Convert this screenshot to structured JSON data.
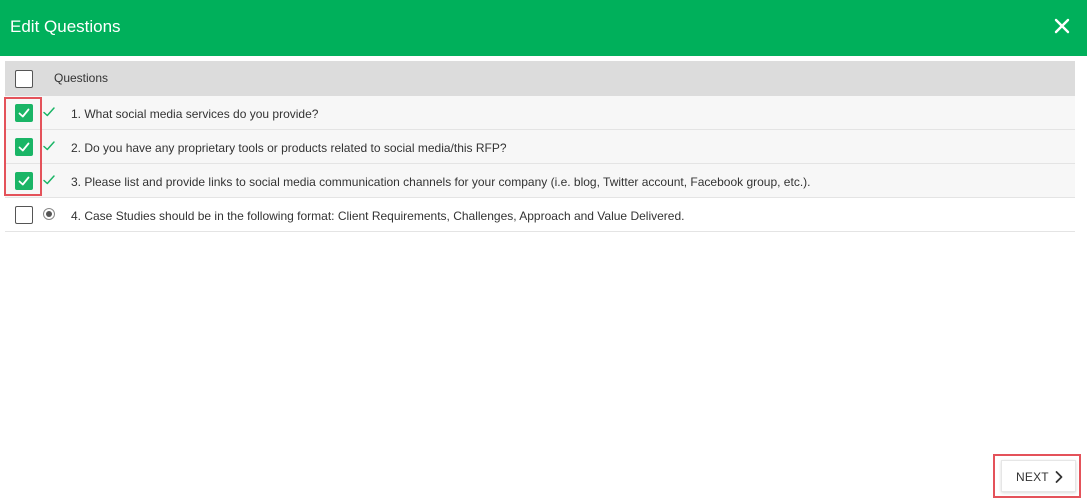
{
  "dialog": {
    "title": "Edit Questions"
  },
  "table": {
    "header_label": "Questions",
    "header_selected": false,
    "rows": [
      {
        "text": "1. What social media services do you provide?",
        "selected": true,
        "status": "check-icon"
      },
      {
        "text": "2. Do you have any proprietary tools or products related to social media/this RFP?",
        "selected": true,
        "status": "check-icon"
      },
      {
        "text": "3. Please list and provide links to social media communication channels for your company (i.e. blog, Twitter account, Facebook group, etc.).",
        "selected": true,
        "status": "check-icon"
      },
      {
        "text": "4. Case Studies should be in the following format: Client Requirements, Challenges, Approach and Value Delivered.",
        "selected": false,
        "status": "radio-selected-icon"
      }
    ]
  },
  "footer": {
    "next_label": "NEXT"
  },
  "colors": {
    "header_bg": "#00b05b",
    "checkbox_on": "#1ab566",
    "highlight": "#e4525a",
    "table_header_bg": "#dcdcdc"
  }
}
